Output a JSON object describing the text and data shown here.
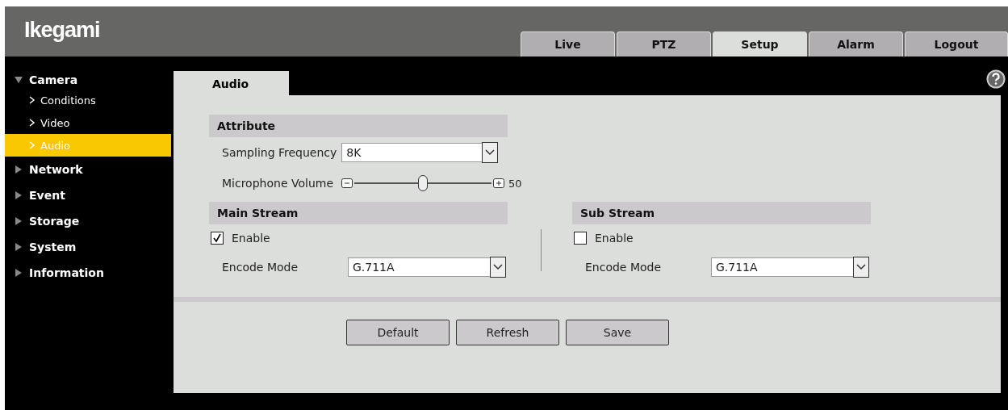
{
  "header": {
    "logo": "Ikegami",
    "tabs": [
      {
        "label": "Live",
        "selected": false
      },
      {
        "label": "PTZ",
        "selected": false
      },
      {
        "label": "Setup",
        "selected": true
      },
      {
        "label": "Alarm",
        "selected": false
      },
      {
        "label": "Logout",
        "selected": false
      }
    ]
  },
  "sidebar": {
    "items": [
      {
        "label": "Camera",
        "expanded": true,
        "children": [
          {
            "label": "Conditions",
            "selected": false
          },
          {
            "label": "Video",
            "selected": false
          },
          {
            "label": "Audio",
            "selected": true
          }
        ]
      },
      {
        "label": "Network",
        "expanded": false
      },
      {
        "label": "Event",
        "expanded": false
      },
      {
        "label": "Storage",
        "expanded": false
      },
      {
        "label": "System",
        "expanded": false
      },
      {
        "label": "Information",
        "expanded": false
      }
    ]
  },
  "content": {
    "tab": "Audio",
    "attribute": {
      "title": "Attribute",
      "sampling_label": "Sampling Frequency",
      "sampling_value": "8K",
      "volume_label": "Microphone Volume",
      "volume": {
        "level": 0.5,
        "reading": "50"
      }
    },
    "streams": [
      {
        "title": "Main Stream",
        "enable_label": "Enable",
        "checked": true,
        "encode_label": "Encode Mode",
        "encode_value": "G.711A"
      },
      {
        "title": "Sub Stream",
        "enable_label": "Enable",
        "checked": false,
        "encode_label": "Encode Mode",
        "encode_value": "G.711A"
      }
    ],
    "buttons": [
      "Default",
      "Refresh",
      "Save"
    ]
  }
}
